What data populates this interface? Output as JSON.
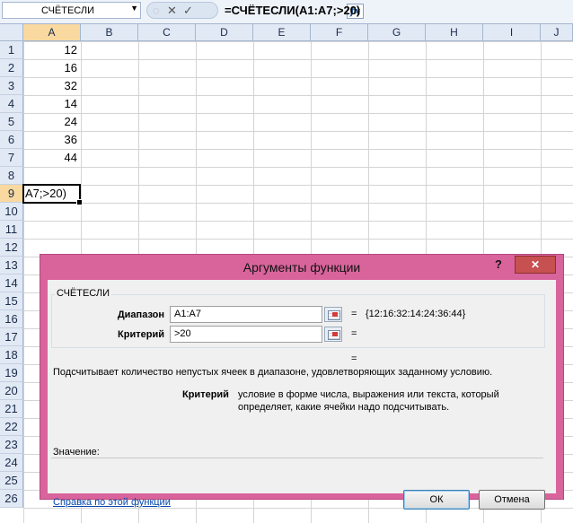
{
  "formula_bar": {
    "name_box": "СЧЁТЕСЛИ",
    "fx_label": "fx",
    "formula": "=СЧЁТЕСЛИ(A1:A7;>20)"
  },
  "columns": [
    "A",
    "B",
    "C",
    "D",
    "E",
    "F",
    "G",
    "H",
    "I",
    "J"
  ],
  "rows": [
    "1",
    "2",
    "3",
    "4",
    "5",
    "6",
    "7",
    "8",
    "9",
    "10",
    "11",
    "12",
    "13",
    "14",
    "15",
    "16",
    "17",
    "18",
    "19",
    "20",
    "21",
    "22",
    "23",
    "24",
    "25",
    "26"
  ],
  "cells_A": [
    "12",
    "16",
    "32",
    "14",
    "24",
    "36",
    "44"
  ],
  "active_cell_text": "A7;>20)",
  "dialog": {
    "title": "Аргументы функции",
    "help": "?",
    "close": "✕",
    "function_name": "СЧЁТЕСЛИ",
    "range_label": "Диапазон",
    "range_value": "A1:A7",
    "range_result": "{12:16:32:14:24:36:44}",
    "criteria_label": "Критерий",
    "criteria_value": ">20",
    "eq": "=",
    "description": "Подсчитывает количество непустых ячеек в диапазоне, удовлетворяющих заданному условию.",
    "arg_name": "Критерий",
    "arg_desc_line1": "условие в форме числа, выражения или текста, который",
    "arg_desc_line2": "определяет, какие ячейки надо подсчитывать.",
    "value_label": "Значение:",
    "help_link": "Справка по этой функции",
    "ok": "ОК",
    "cancel": "Отмена"
  }
}
